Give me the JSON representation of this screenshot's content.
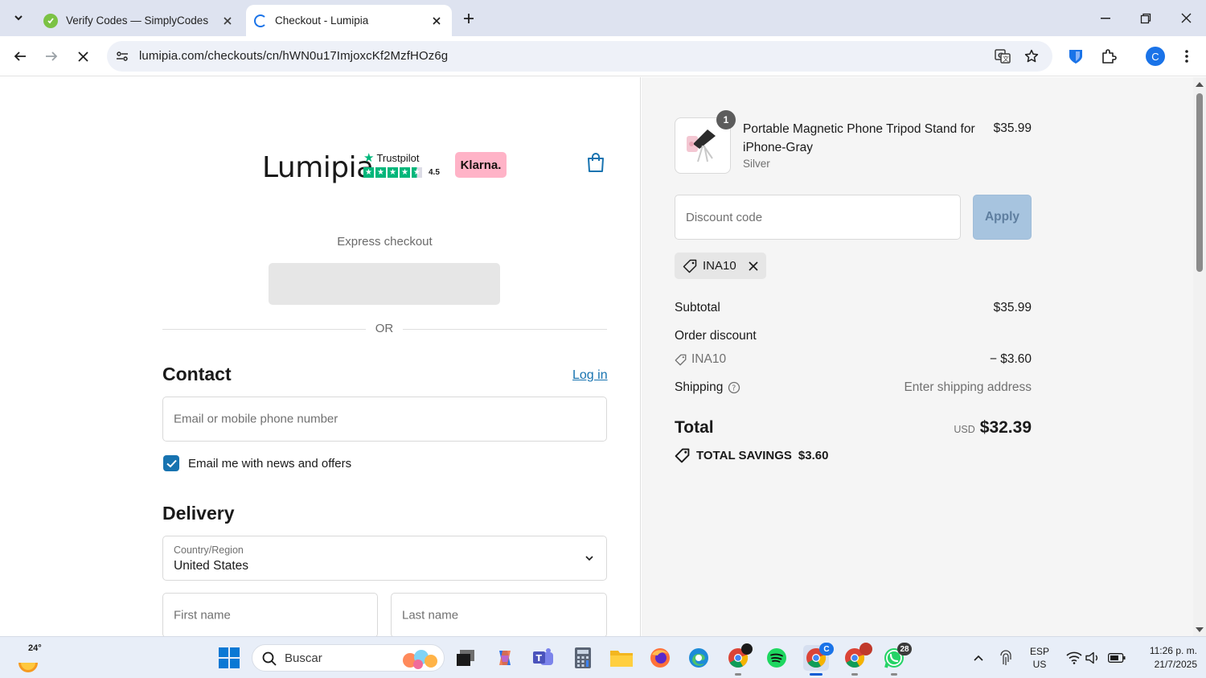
{
  "browser": {
    "tabs": [
      {
        "title": "Verify Codes — SimplyCodes",
        "active": false
      },
      {
        "title": "Checkout - Lumipia",
        "active": true
      }
    ],
    "url": "lumipia.com/checkouts/cn/hWN0u17ImjoxcKf2MzfHOz6g",
    "profile_initial": "C"
  },
  "header": {
    "logo_text": "Lumipia",
    "trustpilot_label": "Trustpilot",
    "trustpilot_rating": "4.5",
    "trustpilot_stars": 4.5,
    "klarna_label": "Klarna."
  },
  "express": {
    "label": "Express checkout",
    "divider_text": "OR"
  },
  "contact": {
    "heading": "Contact",
    "login_link": "Log in",
    "email_placeholder": "Email or mobile phone number",
    "newsletter_label": "Email me with news and offers",
    "newsletter_checked": true
  },
  "delivery": {
    "heading": "Delivery",
    "country_label": "Country/Region",
    "country_value": "United States",
    "first_name_placeholder": "First name",
    "last_name_placeholder": "Last name"
  },
  "order": {
    "item": {
      "quantity": "1",
      "name": "Portable Magnetic Phone Tripod Stand for iPhone-Gray",
      "variant": "Silver",
      "price": "$35.99"
    },
    "discount_placeholder": "Discount code",
    "apply_label": "Apply",
    "applied_code": "INA10",
    "subtotal_label": "Subtotal",
    "subtotal_value": "$35.99",
    "order_discount_label": "Order discount",
    "discount_code": "INA10",
    "discount_value": "− $3.60",
    "shipping_label": "Shipping",
    "shipping_value": "Enter shipping address",
    "total_label": "Total",
    "total_currency": "USD",
    "total_value": "$32.39",
    "savings_label": "TOTAL SAVINGS",
    "savings_value": "$3.60"
  },
  "taskbar": {
    "temperature": "24°",
    "search_label": "Buscar",
    "chrome_badge": "C",
    "whatsapp_badge": "28",
    "lang_line1": "ESP",
    "lang_line2": "US",
    "time": "11:26 p. m.",
    "date": "21/7/2025"
  },
  "colors": {
    "link": "#1773b0",
    "apply_button_disabled": "#a7c4df",
    "klarna_pink": "#ffb3c7",
    "trustpilot_green": "#00b67a",
    "tab_strip": "#dee3f0"
  }
}
